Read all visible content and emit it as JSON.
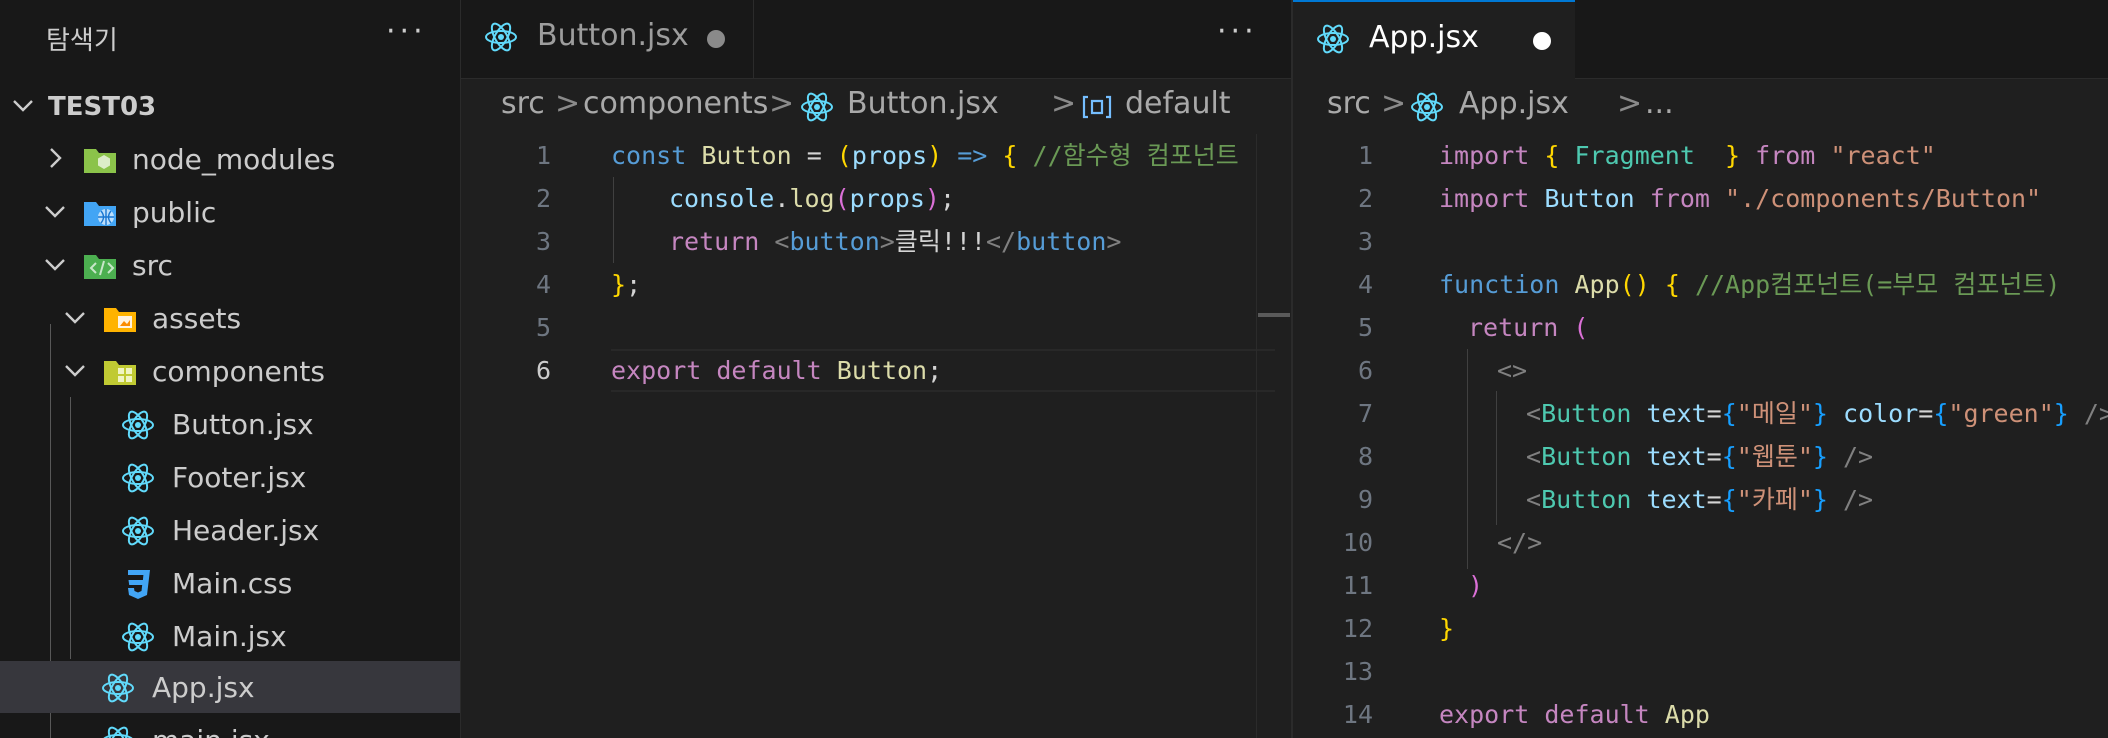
{
  "explorer": {
    "title": "탐색기",
    "more": "···",
    "project": "TEST03",
    "items": [
      {
        "label": "node_modules",
        "icon": "node-folder-icon"
      },
      {
        "label": "public",
        "icon": "globe-folder-icon"
      },
      {
        "label": "src",
        "icon": "code-folder-icon"
      },
      {
        "label": "assets",
        "icon": "assets-folder-icon"
      },
      {
        "label": "components",
        "icon": "components-folder-icon"
      },
      {
        "label": "Button.jsx",
        "icon": "react-icon"
      },
      {
        "label": "Footer.jsx",
        "icon": "react-icon"
      },
      {
        "label": "Header.jsx",
        "icon": "react-icon"
      },
      {
        "label": "Main.css",
        "icon": "css-icon"
      },
      {
        "label": "Main.jsx",
        "icon": "react-icon"
      },
      {
        "label": "App.jsx",
        "icon": "react-icon"
      },
      {
        "label": "main.jsx",
        "icon": "react-icon"
      }
    ]
  },
  "left_editor": {
    "tab": "Button.jsx",
    "more": "···",
    "breadcrumbs": [
      "src",
      "components",
      "Button.jsx",
      "default"
    ],
    "separator": ">",
    "line_numbers": [
      "1",
      "2",
      "3",
      "4",
      "5",
      "6"
    ],
    "code": {
      "l1": {
        "t1": "const",
        "t2": " ",
        "t3": "Button",
        "t4": " = ",
        "t5": "(",
        "t6": "props",
        "t7": ")",
        "t8": " ",
        "t9": "=>",
        "t10": " ",
        "t11": "{",
        "t12": " ",
        "t13": "//함수형 컴포넌트"
      },
      "l2": {
        "t1": "console",
        "t2": ".",
        "t3": "log",
        "t4": "(",
        "t5": "props",
        "t6": ")",
        "t7": ";"
      },
      "l3": {
        "t1": "return",
        "t2": " ",
        "t3": "<",
        "t4": "button",
        "t5": ">",
        "t6": "클릭!!!",
        "t7": "</",
        "t8": "button",
        "t9": ">"
      },
      "l4": {
        "t1": "}",
        "t2": ";"
      },
      "l6": {
        "t1": "export",
        "t2": " ",
        "t3": "default",
        "t4": " ",
        "t5": "Button",
        "t6": ";"
      }
    }
  },
  "right_editor": {
    "tab": "App.jsx",
    "breadcrumbs": [
      "src",
      "App.jsx",
      "..."
    ],
    "separator": ">",
    "line_numbers": [
      "1",
      "2",
      "3",
      "4",
      "5",
      "6",
      "7",
      "8",
      "9",
      "10",
      "11",
      "12",
      "13",
      "14"
    ],
    "code": {
      "l1": {
        "t1": "import",
        "t2": " ",
        "t3": "{",
        "t4": " ",
        "t5": "Fragment",
        "t6": "  ",
        "t7": "}",
        "t8": " ",
        "t9": "from",
        "t10": " ",
        "t11": "\"react\""
      },
      "l2": {
        "t1": "import",
        "t2": " ",
        "t3": "Button",
        "t4": " ",
        "t5": "from",
        "t6": " ",
        "t7": "\"./components/Button\""
      },
      "l4": {
        "t1": "function",
        "t2": " ",
        "t3": "App",
        "t4": "()",
        "t5": " ",
        "t6": "{",
        "t7": " ",
        "t8": "//App컴포넌트(=부모 컴포넌트)"
      },
      "l5": {
        "t1": "return",
        "t2": " ",
        "t3": "("
      },
      "l6": {
        "t1": "<>"
      },
      "l7": {
        "t1": "<",
        "t2": "Button",
        "t3": " ",
        "t4": "text",
        "t5": "=",
        "t6": "{",
        "t7": "\"메일\"",
        "t8": "}",
        "t9": " ",
        "t10": "color",
        "t11": "=",
        "t12": "{",
        "t13": "\"green\"",
        "t14": "}",
        "t15": " />"
      },
      "l8": {
        "t1": "<",
        "t2": "Button",
        "t3": " ",
        "t4": "text",
        "t5": "=",
        "t6": "{",
        "t7": "\"웹툰\"",
        "t8": "}",
        "t9": " />"
      },
      "l9": {
        "t1": "<",
        "t2": "Button",
        "t3": " ",
        "t4": "text",
        "t5": "=",
        "t6": "{",
        "t7": "\"카페\"",
        "t8": "}",
        "t9": " />"
      },
      "l10": {
        "t1": "</>"
      },
      "l11": {
        "t1": ")"
      },
      "l12": {
        "t1": "}"
      },
      "l14": {
        "t1": "export",
        "t2": " ",
        "t3": "default",
        "t4": " ",
        "t5": "App"
      }
    }
  },
  "colors": {
    "react": "#61dafb",
    "modified_dot": "#ffffff",
    "css": "#42a5f5"
  }
}
